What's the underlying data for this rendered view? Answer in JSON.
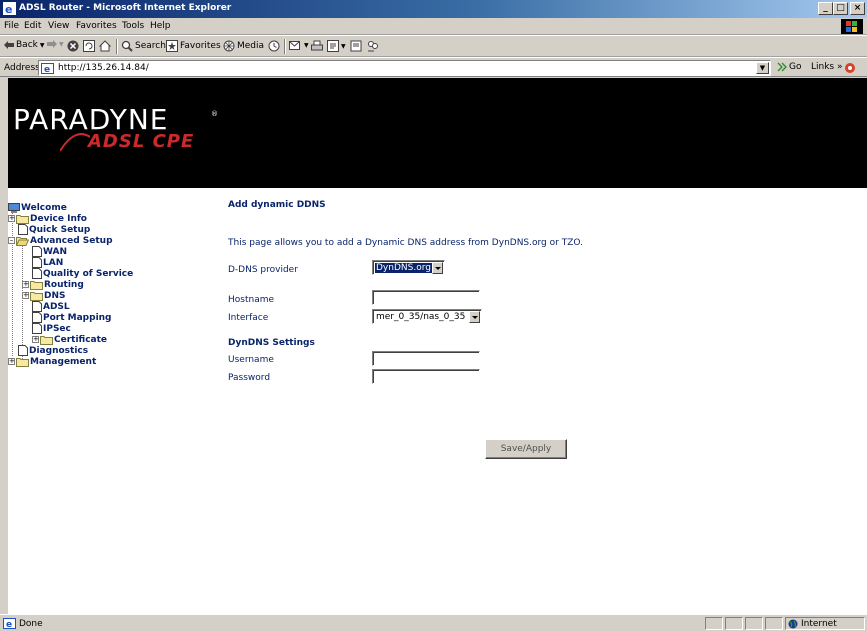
{
  "window": {
    "title": "ADSL Router - Microsoft Internet Explorer",
    "controls": {
      "minimize": "_",
      "maximize": "□",
      "close": "×"
    }
  },
  "menubar": {
    "items": [
      "File",
      "Edit",
      "View",
      "Favorites",
      "Tools",
      "Help"
    ]
  },
  "toolbar": {
    "back": "Back",
    "search": "Search",
    "favorites": "Favorites",
    "media": "Media"
  },
  "addressbar": {
    "label": "Address",
    "url": "http://135.26.14.84/",
    "go": "Go",
    "links": "Links »"
  },
  "banner": {
    "brand": "PARADYNE",
    "registered": "®",
    "product": "ADSL CPE"
  },
  "nav": {
    "welcome": "Welcome",
    "device_info": "Device Info",
    "quick_setup": "Quick Setup",
    "advanced_setup": "Advanced Setup",
    "wan": "WAN",
    "lan": "LAN",
    "qos": "Quality of Service",
    "routing": "Routing",
    "dns": "DNS",
    "adsl": "ADSL",
    "port_mapping": "Port Mapping",
    "ipsec": "IPSec",
    "certificate": "Certificate",
    "diagnostics": "Diagnostics",
    "management": "Management"
  },
  "form": {
    "heading": "Add dynamic DDNS",
    "description": "This page allows you to add a Dynamic DNS address from DynDNS.org or TZO.",
    "provider_label": "D-DNS provider",
    "provider_value": "DynDNS.org",
    "hostname_label": "Hostname",
    "hostname_value": "",
    "interface_label": "Interface",
    "interface_value": "mer_0_35/nas_0_35",
    "settings_heading": "DynDNS Settings",
    "username_label": "Username",
    "username_value": "",
    "password_label": "Password",
    "password_value": "",
    "save_label": "Save/Apply"
  },
  "statusbar": {
    "status": "Done",
    "zone": "Internet"
  },
  "colors": {
    "link_navy": "#0a246a",
    "banner_bg": "#000000",
    "logo_red": "#cc2a2a",
    "chrome": "#d4d0c8"
  }
}
